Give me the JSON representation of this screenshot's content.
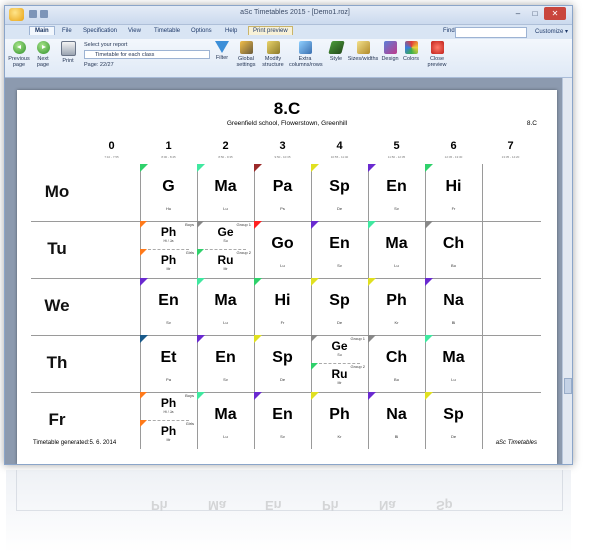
{
  "window": {
    "title": "aSc Timetables 2015 - [Demo1.roz]",
    "controls": [
      "–",
      "□",
      "✕"
    ]
  },
  "menu": {
    "tabs": [
      "Main",
      "File",
      "Specification",
      "View",
      "Timetable",
      "Options",
      "Help",
      "Print preview"
    ],
    "find_label": "Find:",
    "customize": "Customize ▾"
  },
  "ribbon": {
    "buttons": [
      {
        "label": "Previous page",
        "icon": "prev-page-icon"
      },
      {
        "label": "Next page",
        "icon": "next-page-icon"
      },
      {
        "label": "Print",
        "icon": "printer-icon"
      },
      {
        "label": "Filter",
        "icon": "filter-icon"
      },
      {
        "label": "Global settings",
        "icon": "global-settings-icon"
      },
      {
        "label": "Modify structure",
        "icon": "modify-structure-icon"
      },
      {
        "label": "Extra columns/rows",
        "icon": "extra-columns-icon"
      },
      {
        "label": "Style",
        "icon": "style-icon"
      },
      {
        "label": "Sizes/widths",
        "icon": "sizes-icon"
      },
      {
        "label": "Design",
        "icon": "design-icon"
      },
      {
        "label": "Colors",
        "icon": "colors-icon"
      },
      {
        "label": "Close preview",
        "icon": "close-preview-icon"
      }
    ],
    "report_label": "Select your report",
    "report_value": "Timetable for each class",
    "page_indicator": "Page: 22/27"
  },
  "timetable": {
    "class_name": "8.C",
    "school": "Greenfield school, Flowerstown, Greenhill",
    "class_right": "8.C",
    "periods": [
      {
        "num": "0",
        "time": "7:10 - 7:55"
      },
      {
        "num": "1",
        "time": "8:00 - 8:45"
      },
      {
        "num": "2",
        "time": "8:50 - 9:35"
      },
      {
        "num": "3",
        "time": "9:50 - 10:35"
      },
      {
        "num": "4",
        "time": "10:55 - 11:40"
      },
      {
        "num": "5",
        "time": "11:50 - 12:35"
      },
      {
        "num": "6",
        "time": "12:45 - 13:30"
      },
      {
        "num": "7",
        "time": "13:35 - 14:20"
      }
    ],
    "days": [
      {
        "name": "Mo",
        "cells": [
          null,
          {
            "s": "G",
            "t": "Hu",
            "c": "#2fd16b"
          },
          {
            "s": "Ma",
            "t": "Lu",
            "c": "#40e8a0"
          },
          {
            "s": "Pa",
            "t": "Ps",
            "c": "#9b2a2a"
          },
          {
            "s": "Sp",
            "t": "De",
            "c": "#e0e020"
          },
          {
            "s": "En",
            "t": "Sv",
            "c": "#6a2ad0"
          },
          {
            "s": "Hi",
            "t": "Fr",
            "c": "#2fd16b"
          },
          null
        ]
      },
      {
        "name": "Tu",
        "cells": [
          null,
          {
            "split": [
              {
                "s": "Ph",
                "t": "Hi / Ja",
                "g": "Boys",
                "c": "#ff7a1a"
              },
              {
                "s": "Ph",
                "t": "Mr",
                "g": "Girls",
                "c": "#ff7a1a"
              }
            ]
          },
          {
            "split": [
              {
                "s": "Ge",
                "t": "Su",
                "g": "Group 1",
                "c": "#888888"
              },
              {
                "s": "Ru",
                "t": "Mr",
                "g": "Group 2",
                "c": "#2fd16b"
              }
            ]
          },
          {
            "s": "Go",
            "t": "Lu",
            "c": "#ff2020"
          },
          {
            "s": "En",
            "t": "Sv",
            "c": "#6a2ad0"
          },
          {
            "s": "Ma",
            "t": "Lu",
            "c": "#40e8a0"
          },
          {
            "s": "Ch",
            "t": "Bo",
            "c": "#888888"
          },
          null
        ]
      },
      {
        "name": "We",
        "cells": [
          null,
          {
            "s": "En",
            "t": "Sv",
            "c": "#6a2ad0"
          },
          {
            "s": "Ma",
            "t": "Lu",
            "c": "#40e8a0"
          },
          {
            "s": "Hi",
            "t": "Fr",
            "c": "#2fd16b"
          },
          {
            "s": "Sp",
            "t": "De",
            "c": "#e0e020"
          },
          {
            "s": "Ph",
            "t": "Kr",
            "c": "#e0e020"
          },
          {
            "s": "Na",
            "t": "Bl",
            "c": "#6a2ad0"
          },
          null
        ]
      },
      {
        "name": "Th",
        "cells": [
          null,
          {
            "s": "Et",
            "t": "Pa",
            "c": "#1a5a8a"
          },
          {
            "s": "En",
            "t": "Sv",
            "c": "#6a2ad0"
          },
          {
            "s": "Sp",
            "t": "De",
            "c": "#e0e020"
          },
          {
            "split": [
              {
                "s": "Ge",
                "t": "Su",
                "g": "Group 1",
                "c": "#888888"
              },
              {
                "s": "Ru",
                "t": "Mr",
                "g": "Group 2",
                "c": "#2fd16b"
              }
            ]
          },
          {
            "s": "Ch",
            "t": "Bo",
            "c": "#888888"
          },
          {
            "s": "Ma",
            "t": "Lu",
            "c": "#40e8a0"
          },
          null
        ]
      },
      {
        "name": "Fr",
        "cells": [
          null,
          {
            "split": [
              {
                "s": "Ph",
                "t": "Hi / Ja",
                "g": "Boys",
                "c": "#ff7a1a"
              },
              {
                "s": "Ph",
                "t": "Mr",
                "g": "Girls",
                "c": "#ff7a1a"
              }
            ]
          },
          {
            "s": "Ma",
            "t": "Lu",
            "c": "#40e8a0"
          },
          {
            "s": "En",
            "t": "Sv",
            "c": "#6a2ad0"
          },
          {
            "s": "Ph",
            "t": "Kr",
            "c": "#e0e020"
          },
          {
            "s": "Na",
            "t": "Bl",
            "c": "#6a2ad0"
          },
          {
            "s": "Sp",
            "t": "De",
            "c": "#e0e020"
          },
          null
        ]
      }
    ],
    "footer_left": "Timetable generated:5. 6. 2014",
    "footer_right": "aSc Timetables"
  }
}
